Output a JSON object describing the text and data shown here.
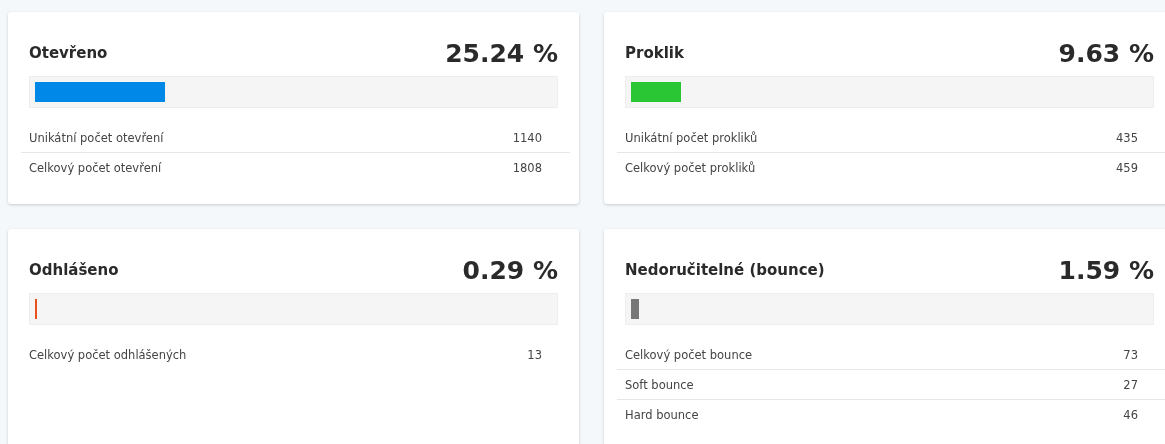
{
  "cards": [
    {
      "title": "Otevřeno",
      "percent": "25.24 %",
      "level": 0.2524,
      "color": "#0088e8",
      "rows": [
        {
          "label": "Unikátní počet otevření",
          "value": "1140"
        },
        {
          "label": "Celkový počet otevření",
          "value": "1808"
        }
      ]
    },
    {
      "title": "Proklik",
      "percent": "9.63 %",
      "level": 0.0963,
      "color": "#2bc634",
      "rows": [
        {
          "label": "Unikátní počet prokliků",
          "value": "435"
        },
        {
          "label": "Celkový počet prokliků",
          "value": "459"
        }
      ]
    },
    {
      "title": "Odhlášeno",
      "percent": "0.29 %",
      "level": 0.0029,
      "color": "#e8501e",
      "rows": [
        {
          "label": "Celkový počet odhlášených",
          "value": "13"
        }
      ]
    },
    {
      "title": "Nedoručitelné (bounce)",
      "percent": "1.59 %",
      "level": 0.0159,
      "color": "#777777",
      "rows": [
        {
          "label": "Celkový počet bounce",
          "value": "73"
        },
        {
          "label": "Soft bounce",
          "value": "27"
        },
        {
          "label": "Hard bounce",
          "value": "46"
        }
      ]
    }
  ]
}
